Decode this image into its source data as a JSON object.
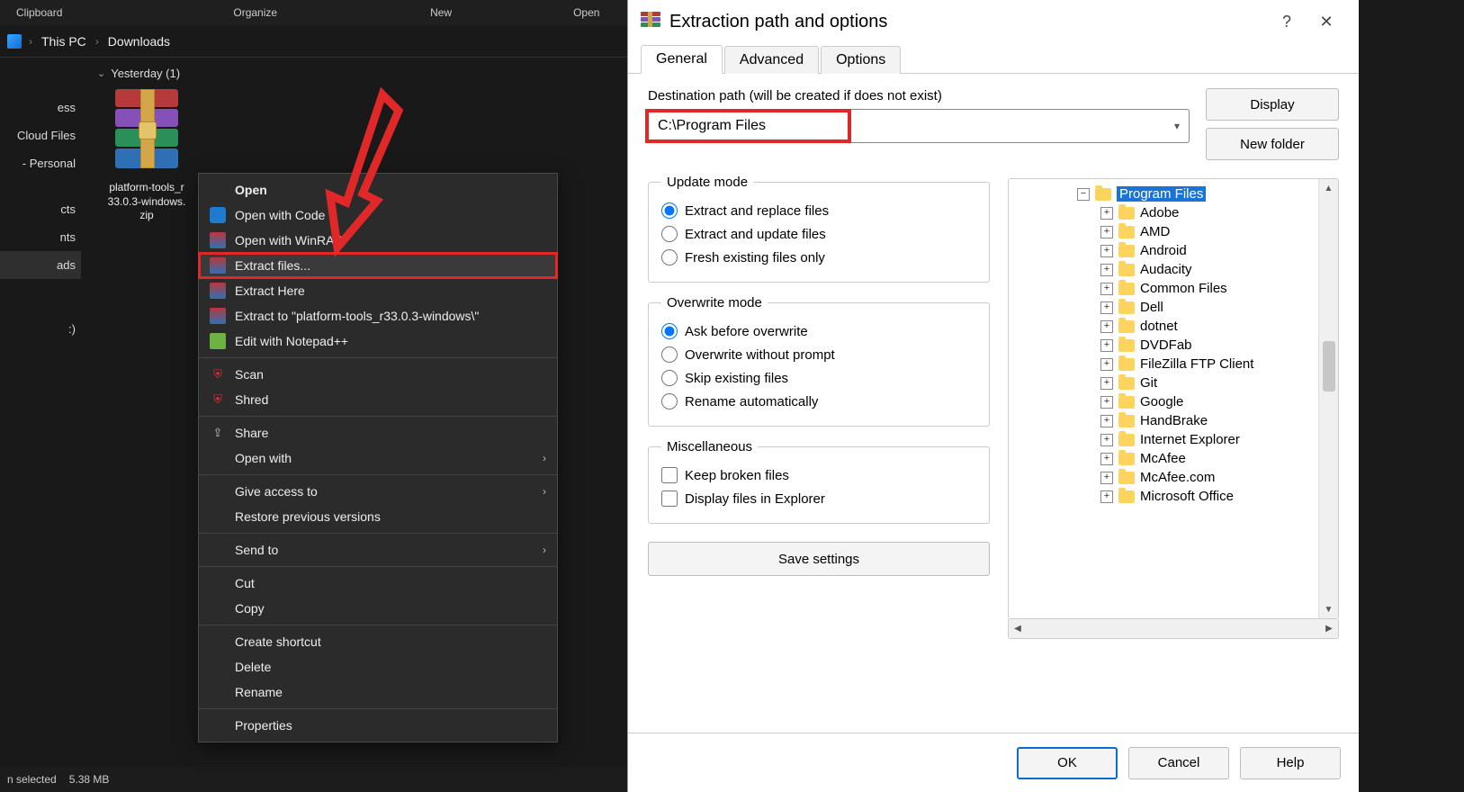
{
  "explorer": {
    "ribbon": {
      "clipboard": "Clipboard",
      "organize": "Organize",
      "new": "New",
      "open": "Open"
    },
    "breadcrumb": {
      "root": "This PC",
      "folder": "Downloads"
    },
    "nav": {
      "ess": "ess",
      "cloud": "Cloud Files",
      "personal": "- Personal",
      "cts": "cts",
      "nts": "nts",
      "ads": "ads",
      "paren": ":)"
    },
    "group_header": "Yesterday (1)",
    "file": {
      "line1": "platform-tools_r",
      "line2": "33.0.3-windows.",
      "line3": "zip"
    },
    "status": {
      "selected": "n selected",
      "size": "5.38 MB"
    }
  },
  "context_menu": {
    "open": "Open",
    "open_code": "Open with Code",
    "open_winrar": "Open with WinRAR",
    "extract_files": "Extract files...",
    "extract_here": "Extract Here",
    "extract_to": "Extract to \"platform-tools_r33.0.3-windows\\\"",
    "edit_np": "Edit with Notepad++",
    "scan": "Scan",
    "shred": "Shred",
    "share": "Share",
    "open_with": "Open with",
    "give_access": "Give access to",
    "restore": "Restore previous versions",
    "send_to": "Send to",
    "cut": "Cut",
    "copy": "Copy",
    "create_shortcut": "Create shortcut",
    "delete": "Delete",
    "rename": "Rename",
    "properties": "Properties"
  },
  "dialog": {
    "title": "Extraction path and options",
    "tabs": {
      "general": "General",
      "advanced": "Advanced",
      "options": "Options"
    },
    "dest_label": "Destination path (will be created if does not exist)",
    "dest_value": "C:\\Program Files",
    "buttons": {
      "display": "Display",
      "new_folder": "New folder",
      "save": "Save settings",
      "ok": "OK",
      "cancel": "Cancel",
      "help": "Help"
    },
    "update_mode": {
      "legend": "Update mode",
      "extract_replace": "Extract and replace files",
      "extract_update": "Extract and update files",
      "fresh": "Fresh existing files only"
    },
    "overwrite_mode": {
      "legend": "Overwrite mode",
      "ask": "Ask before overwrite",
      "without_prompt": "Overwrite without prompt",
      "skip": "Skip existing files",
      "rename": "Rename automatically"
    },
    "misc": {
      "legend": "Miscellaneous",
      "keep_broken": "Keep broken files",
      "display_explorer": "Display files in Explorer"
    },
    "tree": {
      "root": "Program Files",
      "items": [
        "Adobe",
        "AMD",
        "Android",
        "Audacity",
        "Common Files",
        "Dell",
        "dotnet",
        "DVDFab",
        "FileZilla FTP Client",
        "Git",
        "Google",
        "HandBrake",
        "Internet Explorer",
        "McAfee",
        "McAfee.com",
        "Microsoft Office"
      ]
    }
  }
}
